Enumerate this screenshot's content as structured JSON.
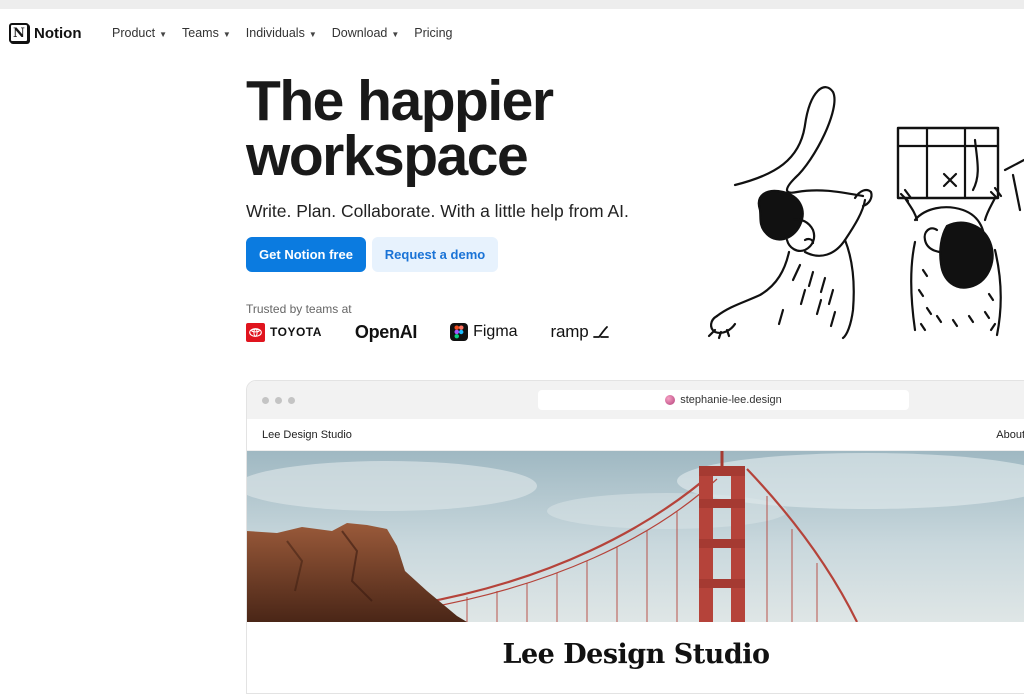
{
  "brand": {
    "name": "Notion",
    "logo_letter": "N"
  },
  "nav": {
    "items": [
      {
        "label": "Product",
        "has_menu": true
      },
      {
        "label": "Teams",
        "has_menu": true
      },
      {
        "label": "Individuals",
        "has_menu": true
      },
      {
        "label": "Download",
        "has_menu": true
      },
      {
        "label": "Pricing",
        "has_menu": false
      }
    ]
  },
  "hero": {
    "title_line1": "The happier",
    "title_line2": "workspace",
    "subtitle": "Write. Plan. Collaborate. With a little help from AI.",
    "primary_cta": "Get Notion free",
    "secondary_cta": "Request a demo"
  },
  "trusted": {
    "label": "Trusted by teams at",
    "logos": [
      "TOYOTA",
      "OpenAI",
      "Figma",
      "ramp"
    ]
  },
  "browser_mock": {
    "url": "stephanie-lee.design",
    "site_name": "Lee Design Studio",
    "site_nav_link": "About",
    "site_heading": "Lee Design Studio"
  },
  "colors": {
    "primary": "#0b7be0",
    "secondary_bg": "#e7f2fd",
    "secondary_text": "#1a73d6",
    "toyota_red": "#e0141e",
    "bridge_red": "#b5433a"
  },
  "icons": [
    "notion-logo-icon",
    "chevron-down-icon",
    "toyota-logo-icon",
    "figma-logo-icon",
    "ramp-logo-icon",
    "site-favicon-icon"
  ]
}
